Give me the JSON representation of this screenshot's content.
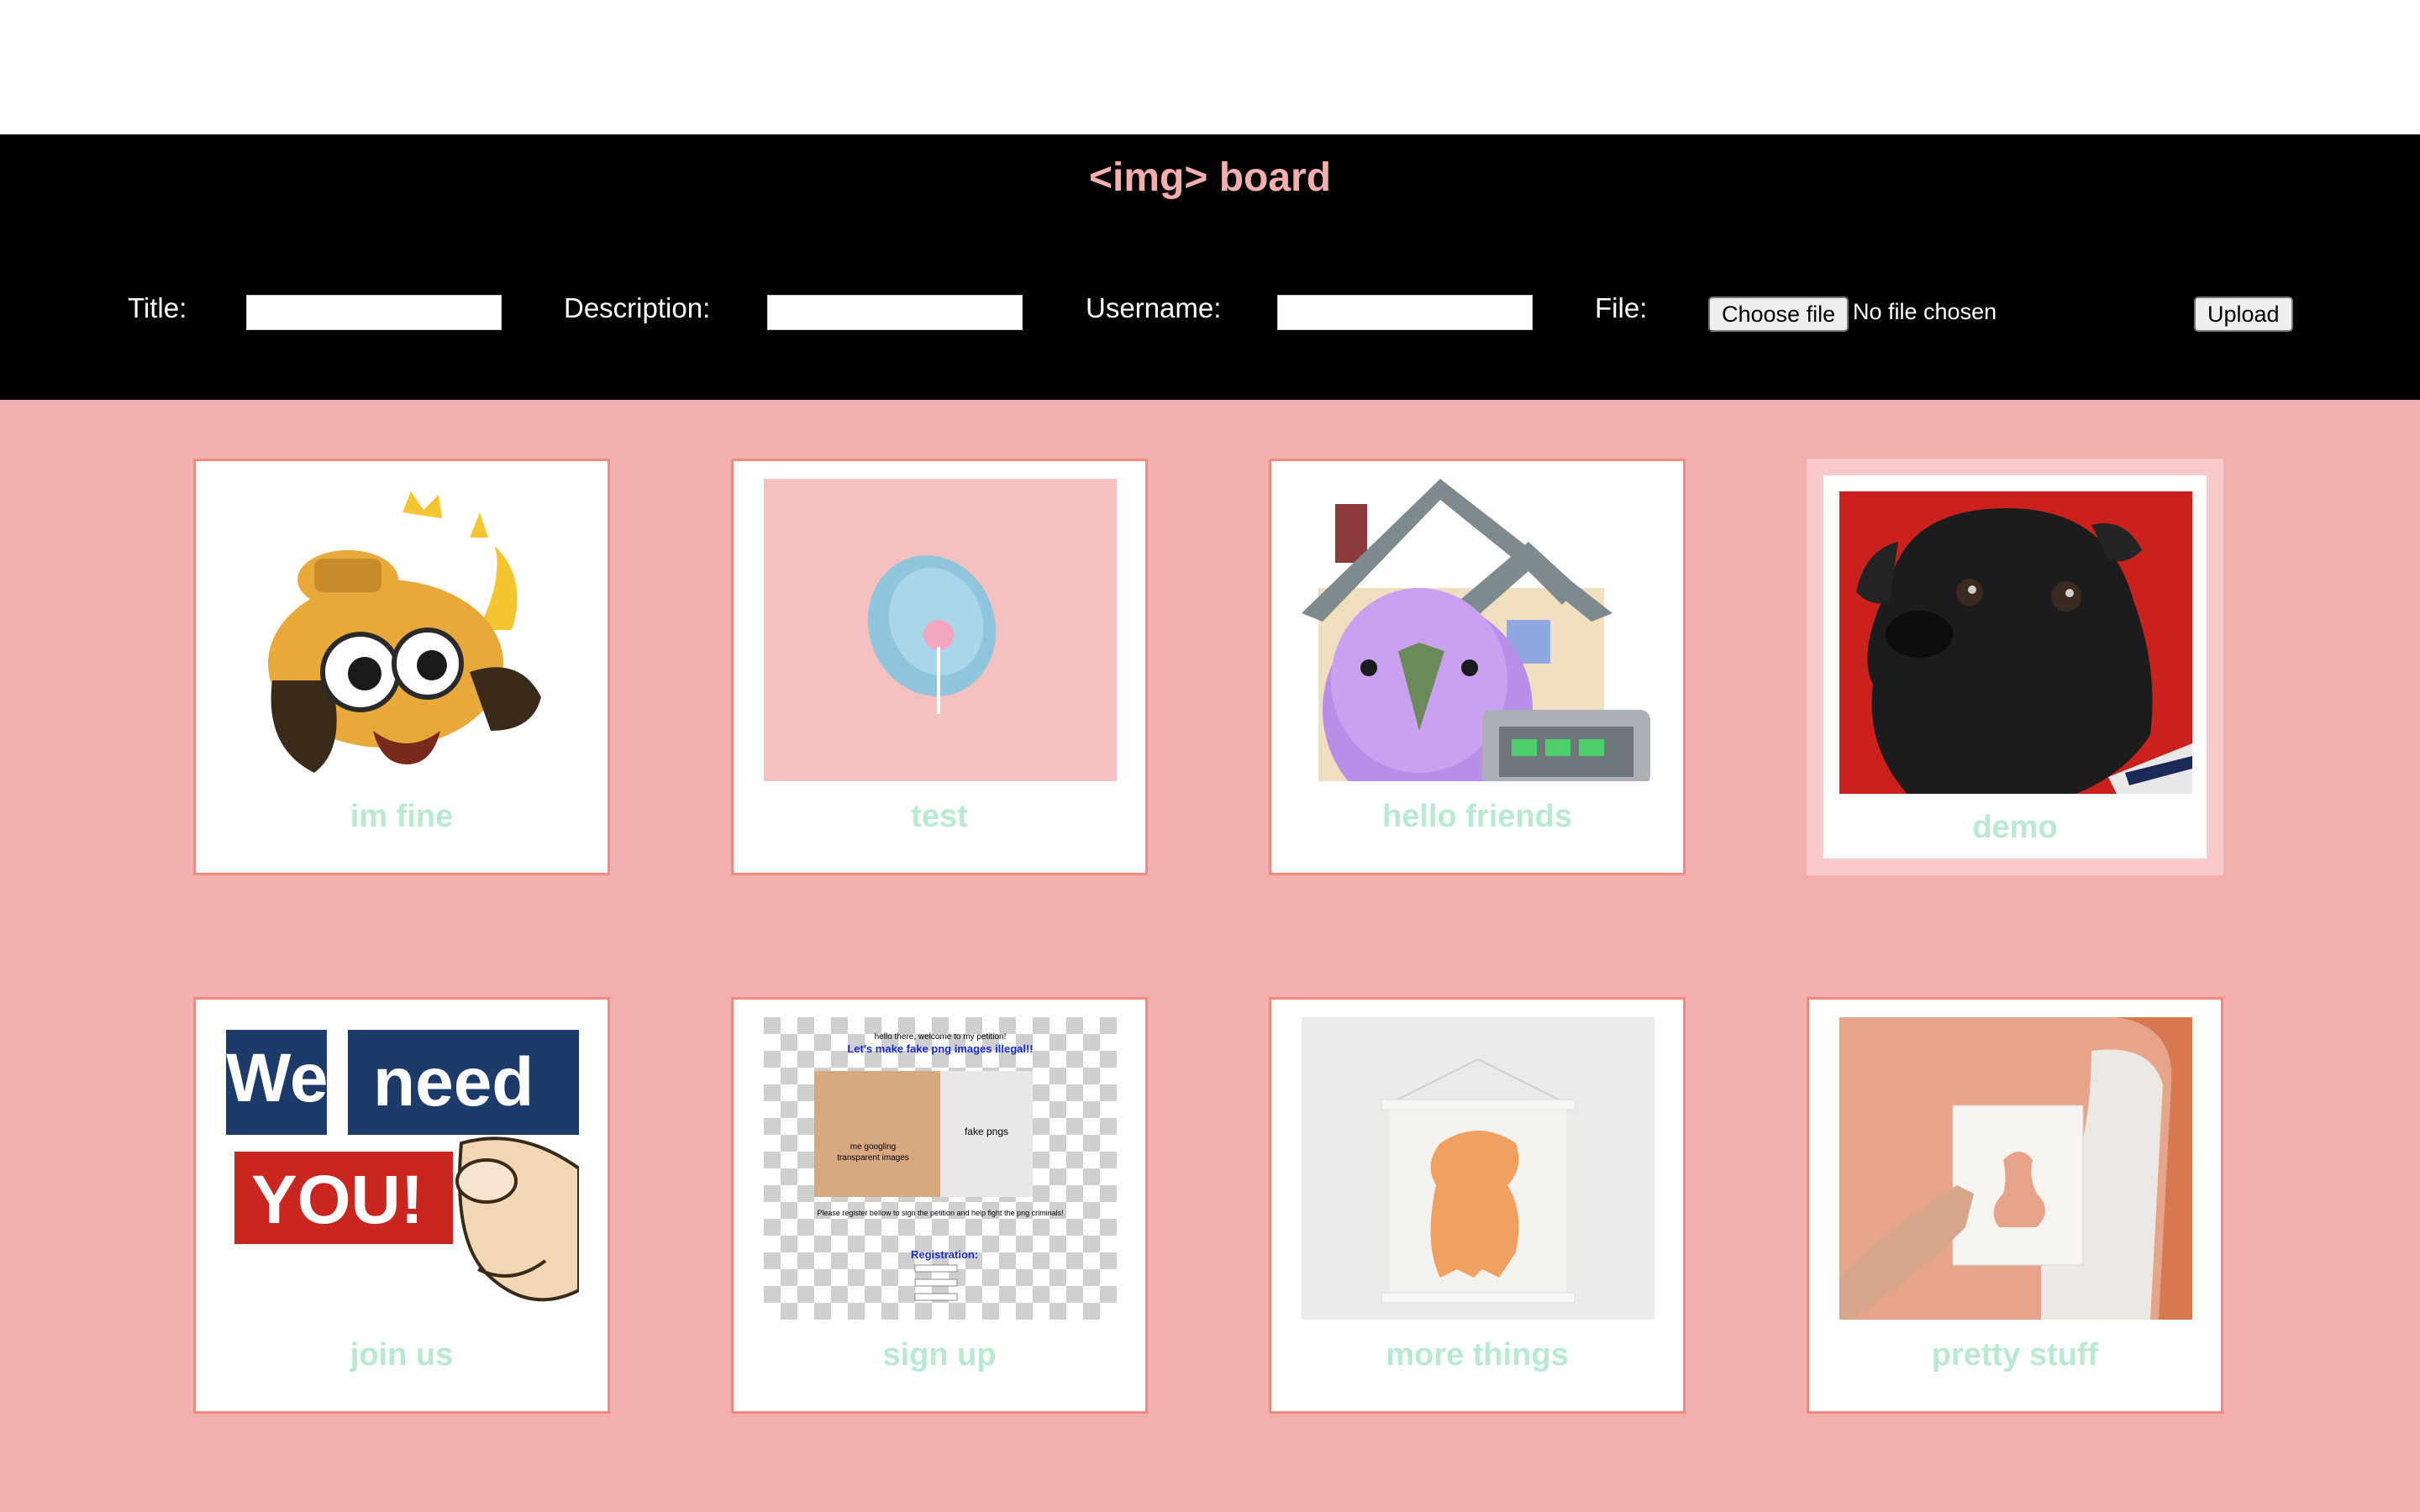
{
  "app": {
    "title": "<img> board"
  },
  "form": {
    "title_label": "Title:",
    "description_label": "Description:",
    "username_label": "Username:",
    "file_label": "File:",
    "title_value": "",
    "description_value": "",
    "username_value": "",
    "choose_file_label": "Choose file",
    "no_file_text": "No file chosen",
    "upload_label": "Upload"
  },
  "images": [
    {
      "title": "im fine",
      "thumbnail": "cartoon-dog-in-fire"
    },
    {
      "title": "test",
      "thumbnail": "lollipop-on-pink"
    },
    {
      "title": "hello friends",
      "thumbnail": "pixel-parrot-house"
    },
    {
      "title": "demo",
      "thumbnail": "pug-on-red"
    },
    {
      "title": "join us",
      "thumbnail": "we-need-you-pointing-hand"
    },
    {
      "title": "sign up",
      "thumbnail": "petition-meme"
    },
    {
      "title": "more things",
      "thumbnail": "orange-bear-poster"
    },
    {
      "title": "pretty stuff",
      "thumbnail": "hand-holding-print-on-wall"
    }
  ],
  "thumb_text": {
    "we": "We",
    "need": "need",
    "you": "YOU!",
    "petition_line1": "hello there, welcome to my petition!",
    "petition_line2": "Let's make fake png images illegal!!",
    "petition_meme_a": "me googling",
    "petition_meme_b": "transparent images",
    "petition_meme_c": "fake pngs",
    "petition_register": "Please register bellow to sign the petition and help fight the png criminals!",
    "petition_reg_title": "Registration:"
  },
  "colors": {
    "page_bg": "#f3aeae",
    "header_bg": "#000000",
    "title_color": "#f3aeae",
    "caption_color": "#b7ead0",
    "card_border": "#f08a80"
  }
}
